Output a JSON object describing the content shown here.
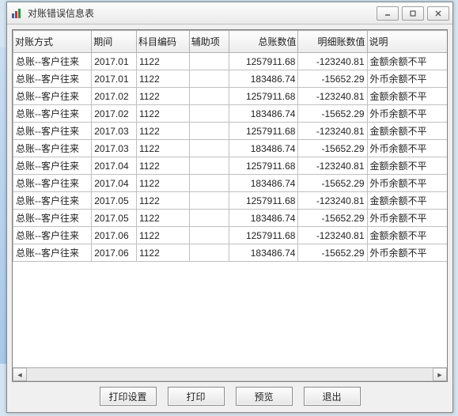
{
  "window": {
    "title": "对账错误信息表"
  },
  "table": {
    "headers": {
      "method": "对账方式",
      "period": "期间",
      "subject": "科目编码",
      "aux": "辅助项",
      "gl": "总账数值",
      "sub": "明细账数值",
      "desc": "说明"
    },
    "rows": [
      {
        "method": "总账--客户往来",
        "period": "2017.01",
        "subject": "1122",
        "aux": "",
        "gl": "1257911.68",
        "sub": "-123240.81",
        "desc": "金额余额不平"
      },
      {
        "method": "总账--客户往来",
        "period": "2017.01",
        "subject": "1122",
        "aux": "",
        "gl": "183486.74",
        "sub": "-15652.29",
        "desc": "外币余额不平"
      },
      {
        "method": "总账--客户往来",
        "period": "2017.02",
        "subject": "1122",
        "aux": "",
        "gl": "1257911.68",
        "sub": "-123240.81",
        "desc": "金额余额不平"
      },
      {
        "method": "总账--客户往来",
        "period": "2017.02",
        "subject": "1122",
        "aux": "",
        "gl": "183486.74",
        "sub": "-15652.29",
        "desc": "外币余额不平"
      },
      {
        "method": "总账--客户往来",
        "period": "2017.03",
        "subject": "1122",
        "aux": "",
        "gl": "1257911.68",
        "sub": "-123240.81",
        "desc": "金额余额不平"
      },
      {
        "method": "总账--客户往来",
        "period": "2017.03",
        "subject": "1122",
        "aux": "",
        "gl": "183486.74",
        "sub": "-15652.29",
        "desc": "外币余额不平"
      },
      {
        "method": "总账--客户往来",
        "period": "2017.04",
        "subject": "1122",
        "aux": "",
        "gl": "1257911.68",
        "sub": "-123240.81",
        "desc": "金额余额不平"
      },
      {
        "method": "总账--客户往来",
        "period": "2017.04",
        "subject": "1122",
        "aux": "",
        "gl": "183486.74",
        "sub": "-15652.29",
        "desc": "外币余额不平"
      },
      {
        "method": "总账--客户往来",
        "period": "2017.05",
        "subject": "1122",
        "aux": "",
        "gl": "1257911.68",
        "sub": "-123240.81",
        "desc": "金额余额不平"
      },
      {
        "method": "总账--客户往来",
        "period": "2017.05",
        "subject": "1122",
        "aux": "",
        "gl": "183486.74",
        "sub": "-15652.29",
        "desc": "外币余额不平"
      },
      {
        "method": "总账--客户往来",
        "period": "2017.06",
        "subject": "1122",
        "aux": "",
        "gl": "1257911.68",
        "sub": "-123240.81",
        "desc": "金额余额不平"
      },
      {
        "method": "总账--客户往来",
        "period": "2017.06",
        "subject": "1122",
        "aux": "",
        "gl": "183486.74",
        "sub": "-15652.29",
        "desc": "外币余额不平"
      }
    ]
  },
  "buttons": {
    "print_setup": "打印设置",
    "print": "打印",
    "preview": "预览",
    "exit": "退出"
  }
}
